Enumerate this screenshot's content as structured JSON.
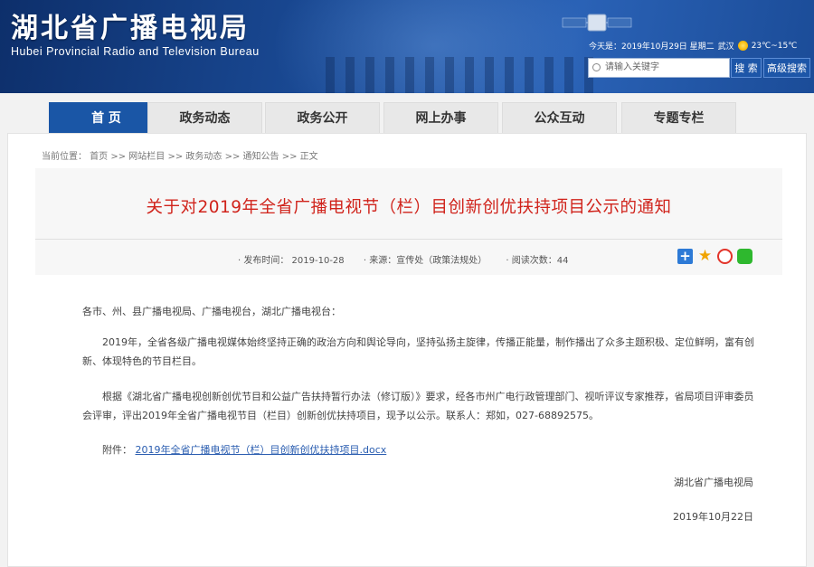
{
  "header": {
    "title_cn": "湖北省广播电视局",
    "title_en": "Hubei Provincial Radio and Television Bureau",
    "date_text": "今天是：2019年10月29日 星期二",
    "weather_city": "武汉",
    "weather_temp": "23℃~15℃",
    "search_placeholder": "请输入关键字",
    "search_button": "搜 索",
    "advanced_button": "高级搜索"
  },
  "nav": {
    "tabs": [
      {
        "label": "首 页",
        "active": true
      },
      {
        "label": "政务动态",
        "active": false
      },
      {
        "label": "政务公开",
        "active": false
      },
      {
        "label": "网上办事",
        "active": false
      },
      {
        "label": "公众互动",
        "active": false
      },
      {
        "label": "专题专栏",
        "active": false
      }
    ]
  },
  "breadcrumb": "当前位置： 首页 >> 网站栏目 >> 政务动态 >> 通知公告 >> 正文",
  "article": {
    "title": "关于对2019年全省广播电视节（栏）目创新创优扶持项目公示的通知",
    "meta": {
      "date": "· 发布时间： 2019-10-28",
      "source": "· 来源：宣传处（政策法规处）",
      "views": "· 阅读次数：44"
    },
    "salutation": "各市、州、县广播电视局、广播电视台，湖北广播电视台：",
    "para1": "2019年，全省各级广播电视媒体始终坚持正确的政治方向和舆论导向，坚持弘扬主旋律，传播正能量，制作播出了众多主题积极、定位鲜明，富有创新、体现特色的节目栏目。",
    "para2": "根据《湖北省广播电视创新创优节目和公益广告扶持暂行办法（修订版）》要求，经各市州广电行政管理部门、视听评议专家推荐，省局项目评审委员会评审，评出2019年全省广播电视节目（栏目）创新创优扶持项目，现予以公示。联系人：郑如，027-68892575。",
    "attachment_label": "附件：",
    "attachment_link": "2019年全省广播电视节（栏）目创新创优扶持项目.docx",
    "signature": "湖北省广播电视局",
    "sign_date": "2019年10月22日"
  }
}
